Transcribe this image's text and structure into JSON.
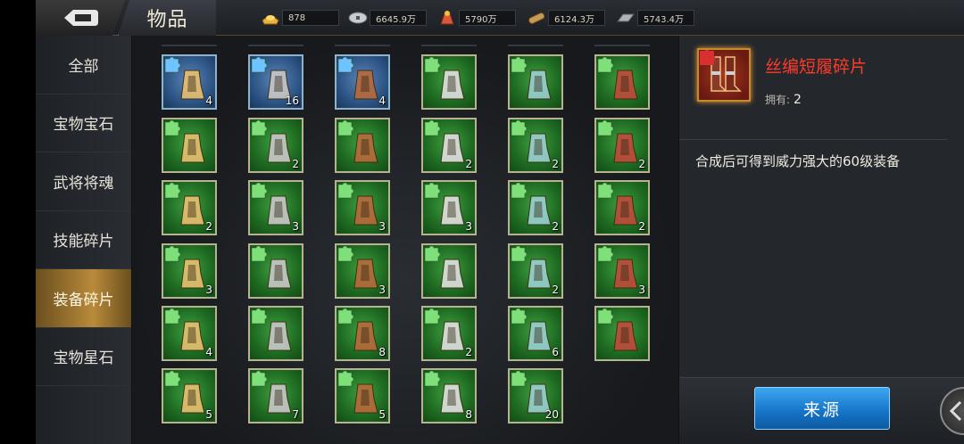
{
  "header": {
    "title": "物品",
    "resources": [
      {
        "icon": "gold-ingot-icon",
        "value": "878",
        "color": "#e8b53a"
      },
      {
        "icon": "silver-coin-icon",
        "value": "6645.9万",
        "color": "#c9ccd0"
      },
      {
        "icon": "grain-sack-icon",
        "value": "5790万",
        "color": "#d9573a"
      },
      {
        "icon": "wood-log-icon",
        "value": "6124.3万",
        "color": "#c79a55"
      },
      {
        "icon": "iron-bar-icon",
        "value": "5743.4万",
        "color": "#aeb3b8"
      }
    ]
  },
  "menu": {
    "items": [
      {
        "label": "全部",
        "active": false
      },
      {
        "label": "宝物宝石",
        "active": false
      },
      {
        "label": "武将将魂",
        "active": false
      },
      {
        "label": "技能碎片",
        "active": false
      },
      {
        "label": "装备碎片",
        "active": true
      },
      {
        "label": "宝物星石",
        "active": false
      }
    ]
  },
  "grid": {
    "items": [
      {
        "icon": "sword-fragment-icon",
        "count": "4",
        "tint": "blue"
      },
      {
        "icon": "golden-boots-fragment-icon",
        "count": "16",
        "tint": "blue"
      },
      {
        "icon": "leather-boots-fragment-icon",
        "count": "4",
        "tint": "blue"
      },
      {
        "icon": "feather-fan-fragment-icon",
        "count": "",
        "tint": "green"
      },
      {
        "icon": "robe-fragment-icon",
        "count": "",
        "tint": "green"
      },
      {
        "icon": "blue-sword-fragment-icon",
        "count": "",
        "tint": "green"
      },
      {
        "icon": "armored-boots-fragment-icon",
        "count": "",
        "tint": "green"
      },
      {
        "icon": "helmet-fragment-icon",
        "count": "2",
        "tint": "green"
      },
      {
        "icon": "golden-greaves-fragment-icon",
        "count": "",
        "tint": "green"
      },
      {
        "icon": "bow-fragment-icon",
        "count": "2",
        "tint": "green"
      },
      {
        "icon": "teal-robe-fragment-icon",
        "count": "2",
        "tint": "green"
      },
      {
        "icon": "red-boots-fragment-icon",
        "count": "2",
        "tint": "green"
      },
      {
        "icon": "whip-blade-fragment-icon",
        "count": "2",
        "tint": "green"
      },
      {
        "icon": "chest-armor-fragment-icon",
        "count": "3",
        "tint": "green"
      },
      {
        "icon": "leather-cap-fragment-icon",
        "count": "3",
        "tint": "green"
      },
      {
        "icon": "brown-boots-fragment-icon",
        "count": "3",
        "tint": "green"
      },
      {
        "icon": "cloak-fragment-icon",
        "count": "2",
        "tint": "green"
      },
      {
        "icon": "jade-belt-fragment-icon",
        "count": "2",
        "tint": "green"
      },
      {
        "icon": "curved-blade-fragment-icon",
        "count": "3",
        "tint": "green"
      },
      {
        "icon": "silver-armor-fragment-icon",
        "count": "",
        "tint": "green"
      },
      {
        "icon": "iron-helmet-fragment-icon",
        "count": "3",
        "tint": "green"
      },
      {
        "icon": "war-boots-fragment-icon",
        "count": "",
        "tint": "green"
      },
      {
        "icon": "axe-fragment-icon",
        "count": "2",
        "tint": "green"
      },
      {
        "icon": "fur-helmet-fragment-icon",
        "count": "3",
        "tint": "green"
      },
      {
        "icon": "plumed-helmet-fragment-icon",
        "count": "4",
        "tint": "green"
      },
      {
        "icon": "red-greaves-fragment-icon",
        "count": "",
        "tint": "green"
      },
      {
        "icon": "crossbow-fragment-icon",
        "count": "8",
        "tint": "green"
      },
      {
        "icon": "fur-armor-fragment-icon",
        "count": "2",
        "tint": "green"
      },
      {
        "icon": "golden-pillar-fragment-icon",
        "count": "6",
        "tint": "green"
      },
      {
        "icon": "gold-leg-armor-fragment-icon",
        "count": "",
        "tint": "green"
      },
      {
        "icon": "golden-staff-fragment-icon",
        "count": "5",
        "tint": "green"
      },
      {
        "icon": "general-armor-fragment-icon",
        "count": "7",
        "tint": "green"
      },
      {
        "icon": "crown-helmet-fragment-icon",
        "count": "5",
        "tint": "green"
      },
      {
        "icon": "plate-boots-fragment-icon",
        "count": "8",
        "tint": "green"
      },
      {
        "icon": "white-robe-fragment-icon",
        "count": "20",
        "tint": "green"
      }
    ]
  },
  "detail": {
    "name": "丝编短履碎片",
    "own_label": "拥有:",
    "own_count": "2",
    "description": "合成后可得到威力强大的60级装备",
    "source_button": "来源",
    "name_color": "#ff3b2a"
  }
}
